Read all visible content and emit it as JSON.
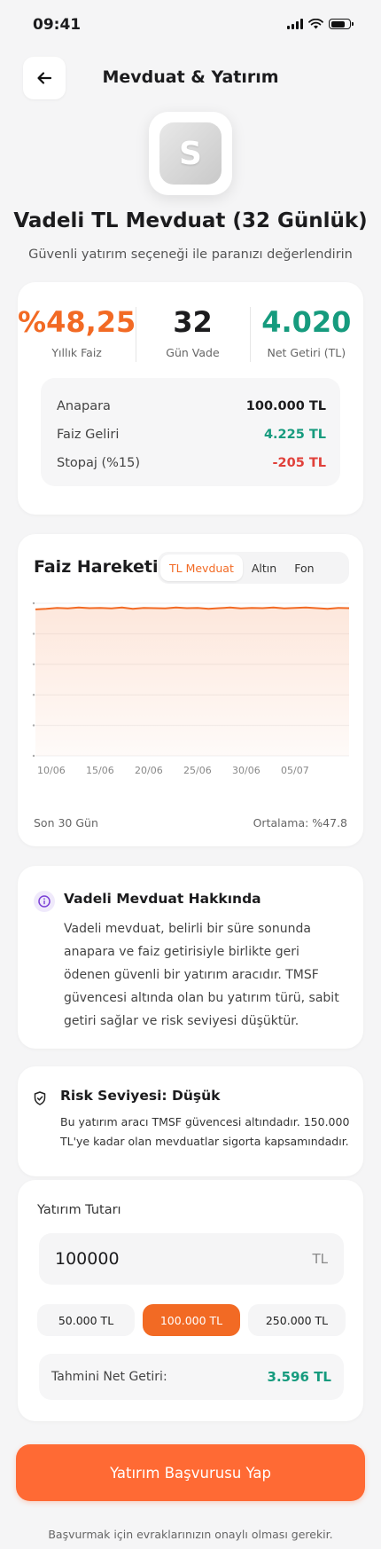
{
  "status": {
    "time": "09:41"
  },
  "header": {
    "title": "Mevduat & Yatırım",
    "back_icon": "arrow-left-icon"
  },
  "product": {
    "logo_letter": "S",
    "title": "Vadeli TL Mevduat (32 Günlük)",
    "subtitle": "Güvenli yatırım seçeneği ile paranızı değerlendirin"
  },
  "stats": [
    {
      "value": "%48,25",
      "label": "Yıllık Faiz",
      "color": "#f26a24"
    },
    {
      "value": "32",
      "label": "Gün Vade",
      "color": "#1c1c1e"
    },
    {
      "value": "4.020",
      "label": "Net Getiri (TL)",
      "color": "#169b7e"
    }
  ],
  "breakdown": [
    {
      "key": "Anapara",
      "value": "100.000 TL",
      "color": "#1c1c1e"
    },
    {
      "key": "Faiz Geliri",
      "value": "4.225 TL",
      "color": "#169b7e"
    },
    {
      "key": "Stopaj (%15)",
      "value": "-205 TL",
      "color": "#e0403a"
    }
  ],
  "chart": {
    "title": "Faiz Hareketi",
    "tabs": [
      "TL Mevduat",
      "Altın",
      "Fon"
    ],
    "active_tab": "TL Mevduat",
    "footer_left": "Son 30 Gün",
    "footer_right": "Ortalama: %47.8"
  },
  "chart_data": {
    "type": "area",
    "title": "Faiz Hareketi",
    "x_tick_labels": [
      "10/06",
      "15/06",
      "20/06",
      "25/06",
      "30/06",
      "05/07"
    ],
    "series": [
      {
        "values": [
          48.0,
          48.2,
          48.5,
          48.3,
          48.6,
          48.4,
          48.5,
          48.3,
          48.6,
          48.2,
          48.5,
          48.4,
          48.3,
          48.6,
          48.4,
          48.5,
          48.2,
          48.4,
          48.6,
          48.3,
          48.5,
          48.4,
          48.6,
          48.3,
          48.5,
          48.6,
          48.4,
          48.2,
          48.5,
          48.4
        ]
      }
    ],
    "ylim": [
      0,
      50
    ],
    "grid": true,
    "color": "#f26a24"
  },
  "info": {
    "icon": "info-icon",
    "title": "Vadeli Mevduat Hakkında",
    "body": "Vadeli mevduat, belirli bir süre sonunda anapara ve faiz getirisiyle birlikte geri ödenen güvenli bir yatırım aracıdır. TMSF güvencesi altında olan bu yatırım türü, sabit getiri sağlar ve risk seviyesi düşüktür."
  },
  "risk": {
    "icon": "shield-icon",
    "title": "Risk Seviyesi: Düşük",
    "body": "Bu yatırım aracı TMSF güvencesi altındadır. 150.000 TL'ye kadar olan mevduatlar sigorta kapsamındadır."
  },
  "investment": {
    "label": "Yatırım Tutarı",
    "amount": "100000",
    "currency": "TL",
    "presets": [
      "50.000 TL",
      "100.000 TL",
      "250.000 TL"
    ],
    "active_preset": "100.000 TL",
    "estimate_label": "Tahmini Net Getiri:",
    "estimate_value": "3.596 TL"
  },
  "cta": {
    "label": "Yatırım Başvurusu Yap"
  },
  "disclaimer": "Başvurmak için evraklarınızın onaylı olması gerekir.",
  "colors": {
    "accent": "#f26a24",
    "positive": "#169b7e",
    "negative": "#e0403a"
  }
}
